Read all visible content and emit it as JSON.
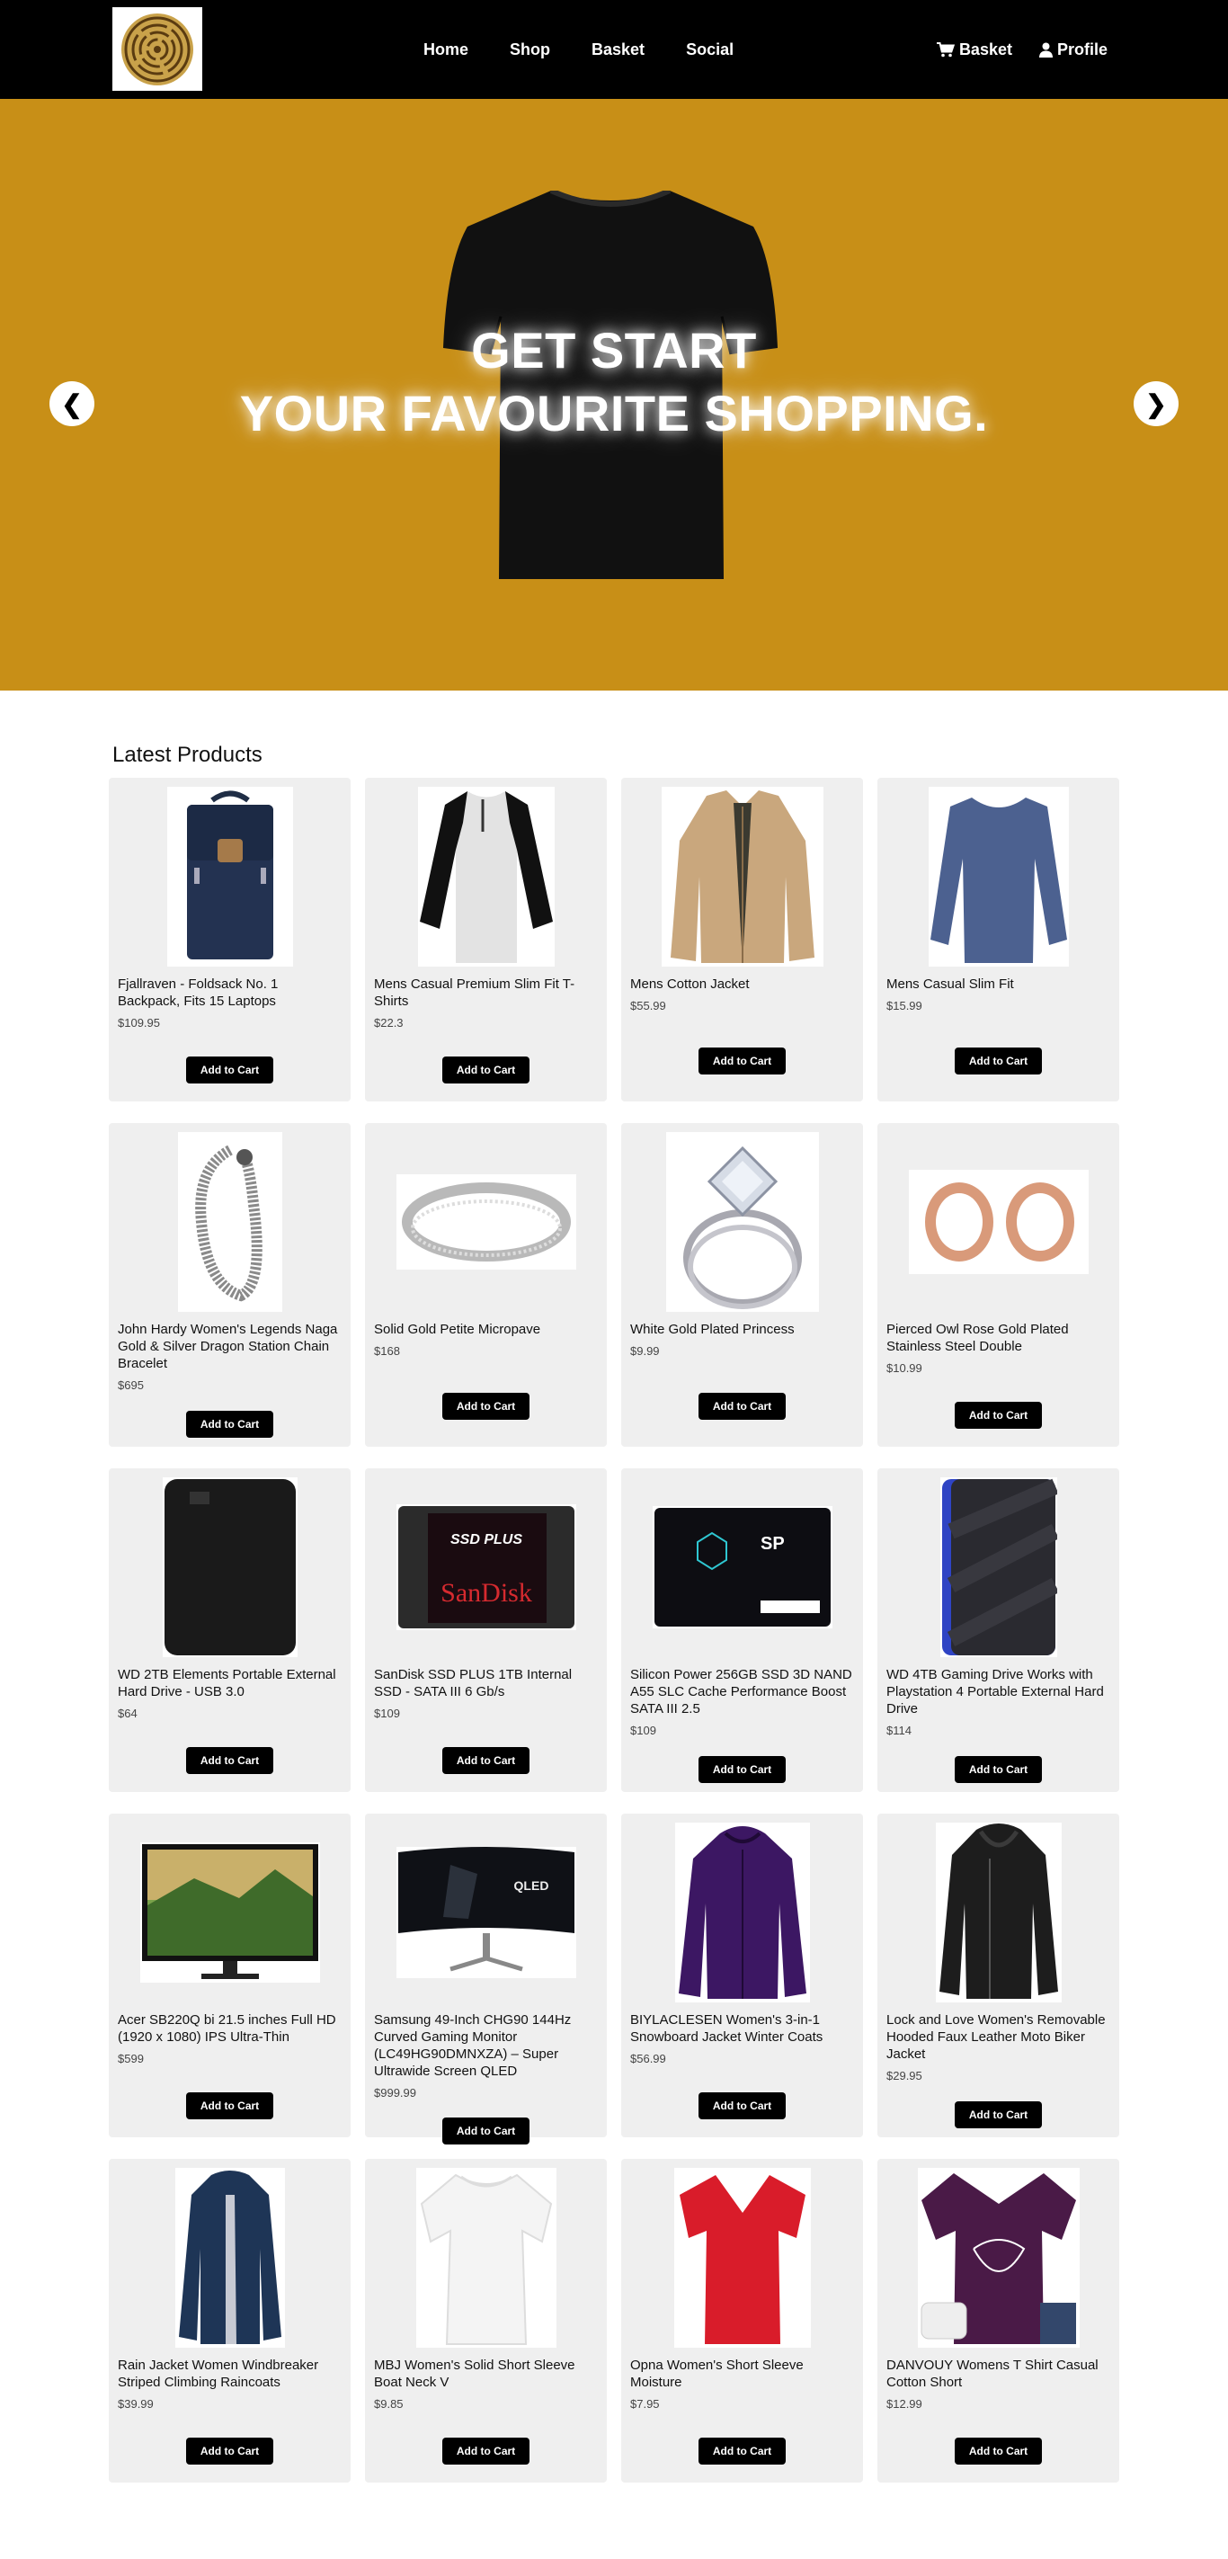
{
  "nav": {
    "links": [
      "Home",
      "Shop",
      "Basket",
      "Social"
    ],
    "basket_label": "Basket",
    "profile_label": "Profile"
  },
  "hero": {
    "line1": "GET START",
    "line2": "YOUR FAVOURITE SHOPPING.",
    "prev_symbol": "❮",
    "next_symbol": "❯",
    "background_color": "#c88f17"
  },
  "products": {
    "title": "Latest Products",
    "button_label": "Add to Cart",
    "items": [
      {
        "name": "Fjallraven - Foldsack No. 1 Backpack, Fits 15 Laptops",
        "price": "$109.95",
        "icon": "backpack-icon"
      },
      {
        "name": "Mens Casual Premium Slim Fit T-Shirts",
        "price": "$22.3",
        "icon": "raglan-shirt-icon"
      },
      {
        "name": "Mens Cotton Jacket",
        "price": "$55.99",
        "icon": "cotton-jacket-icon"
      },
      {
        "name": "Mens Casual Slim Fit",
        "price": "$15.99",
        "icon": "long-sleeve-shirt-icon"
      },
      {
        "name": "John Hardy Women's Legends Naga Gold & Silver Dragon Station Chain Bracelet",
        "price": "$695",
        "icon": "bracelet-icon"
      },
      {
        "name": "Solid Gold Petite Micropave",
        "price": "$168",
        "icon": "ring-icon"
      },
      {
        "name": "White Gold Plated Princess",
        "price": "$9.99",
        "icon": "diamond-ring-icon"
      },
      {
        "name": "Pierced Owl Rose Gold Plated Stainless Steel Double",
        "price": "$10.99",
        "icon": "ear-plugs-icon"
      },
      {
        "name": "WD 2TB Elements Portable External Hard Drive - USB 3.0",
        "price": "$64",
        "icon": "hard-drive-icon"
      },
      {
        "name": "SanDisk SSD PLUS 1TB Internal SSD - SATA III 6 Gb/s",
        "price": "$109",
        "icon": "sandisk-ssd-icon"
      },
      {
        "name": "Silicon Power 256GB SSD 3D NAND A55 SLC Cache Performance Boost SATA III 2.5",
        "price": "$109",
        "icon": "silicon-power-ssd-icon"
      },
      {
        "name": "WD 4TB Gaming Drive Works with Playstation 4 Portable External Hard Drive",
        "price": "$114",
        "icon": "gaming-drive-icon"
      },
      {
        "name": "Acer SB220Q bi 21.5 inches Full HD (1920 x 1080) IPS Ultra-Thin",
        "price": "$599",
        "icon": "monitor-icon"
      },
      {
        "name": "Samsung 49-Inch CHG90 144Hz Curved Gaming Monitor (LC49HG90DMNXZA) – Super Ultrawide Screen QLED",
        "price": "$999.99",
        "icon": "curved-monitor-icon"
      },
      {
        "name": "BIYLACLESEN Women's 3-in-1 Snowboard Jacket Winter Coats",
        "price": "$56.99",
        "icon": "purple-jacket-icon"
      },
      {
        "name": "Lock and Love Women's Removable Hooded Faux Leather Moto Biker Jacket",
        "price": "$29.95",
        "icon": "leather-jacket-icon"
      },
      {
        "name": "Rain Jacket Women Windbreaker Striped Climbing Raincoats",
        "price": "$39.99",
        "icon": "rain-jacket-icon"
      },
      {
        "name": "MBJ Women's Solid Short Sleeve Boat Neck V",
        "price": "$9.85",
        "icon": "white-top-icon"
      },
      {
        "name": "Opna Women's Short Sleeve Moisture",
        "price": "$7.95",
        "icon": "red-shirt-icon"
      },
      {
        "name": "DANVOUY Womens T Shirt Casual Cotton Short",
        "price": "$12.99",
        "icon": "purple-tshirt-icon"
      }
    ]
  }
}
